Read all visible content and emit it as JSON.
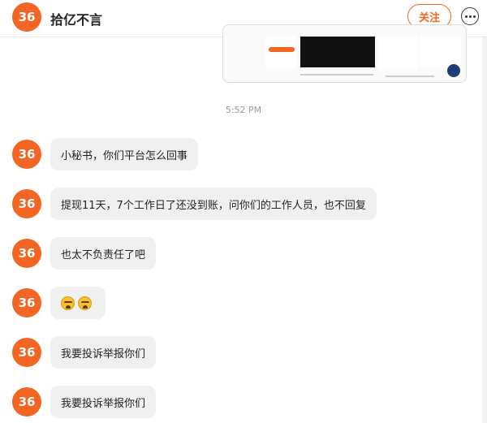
{
  "header": {
    "avatar_text": "36",
    "title": "拾亿不言",
    "follow_label": "关注",
    "more_icon": "more-horizontal-icon"
  },
  "image_message": {
    "icon": "screenshot-thumbnail"
  },
  "timestamp": "5:52 PM",
  "messages": [
    {
      "avatar_text": "36",
      "text": "小秘书，你们平台怎么回事"
    },
    {
      "avatar_text": "36",
      "text": "提现11天，7个工作日了还没到账，问你们的工作人员，也不回复"
    },
    {
      "avatar_text": "36",
      "text": "也太不负责任了吧"
    },
    {
      "avatar_text": "36",
      "emoji": [
        "fearful-face-emoji",
        "fearful-face-emoji"
      ]
    },
    {
      "avatar_text": "36",
      "text": "我要投诉举报你们"
    },
    {
      "avatar_text": "36",
      "text": "我要投诉举报你们"
    }
  ],
  "colors": {
    "brand": "#f26522",
    "bubble": "#f0f0f0",
    "timestamp": "#9a9a9a"
  }
}
